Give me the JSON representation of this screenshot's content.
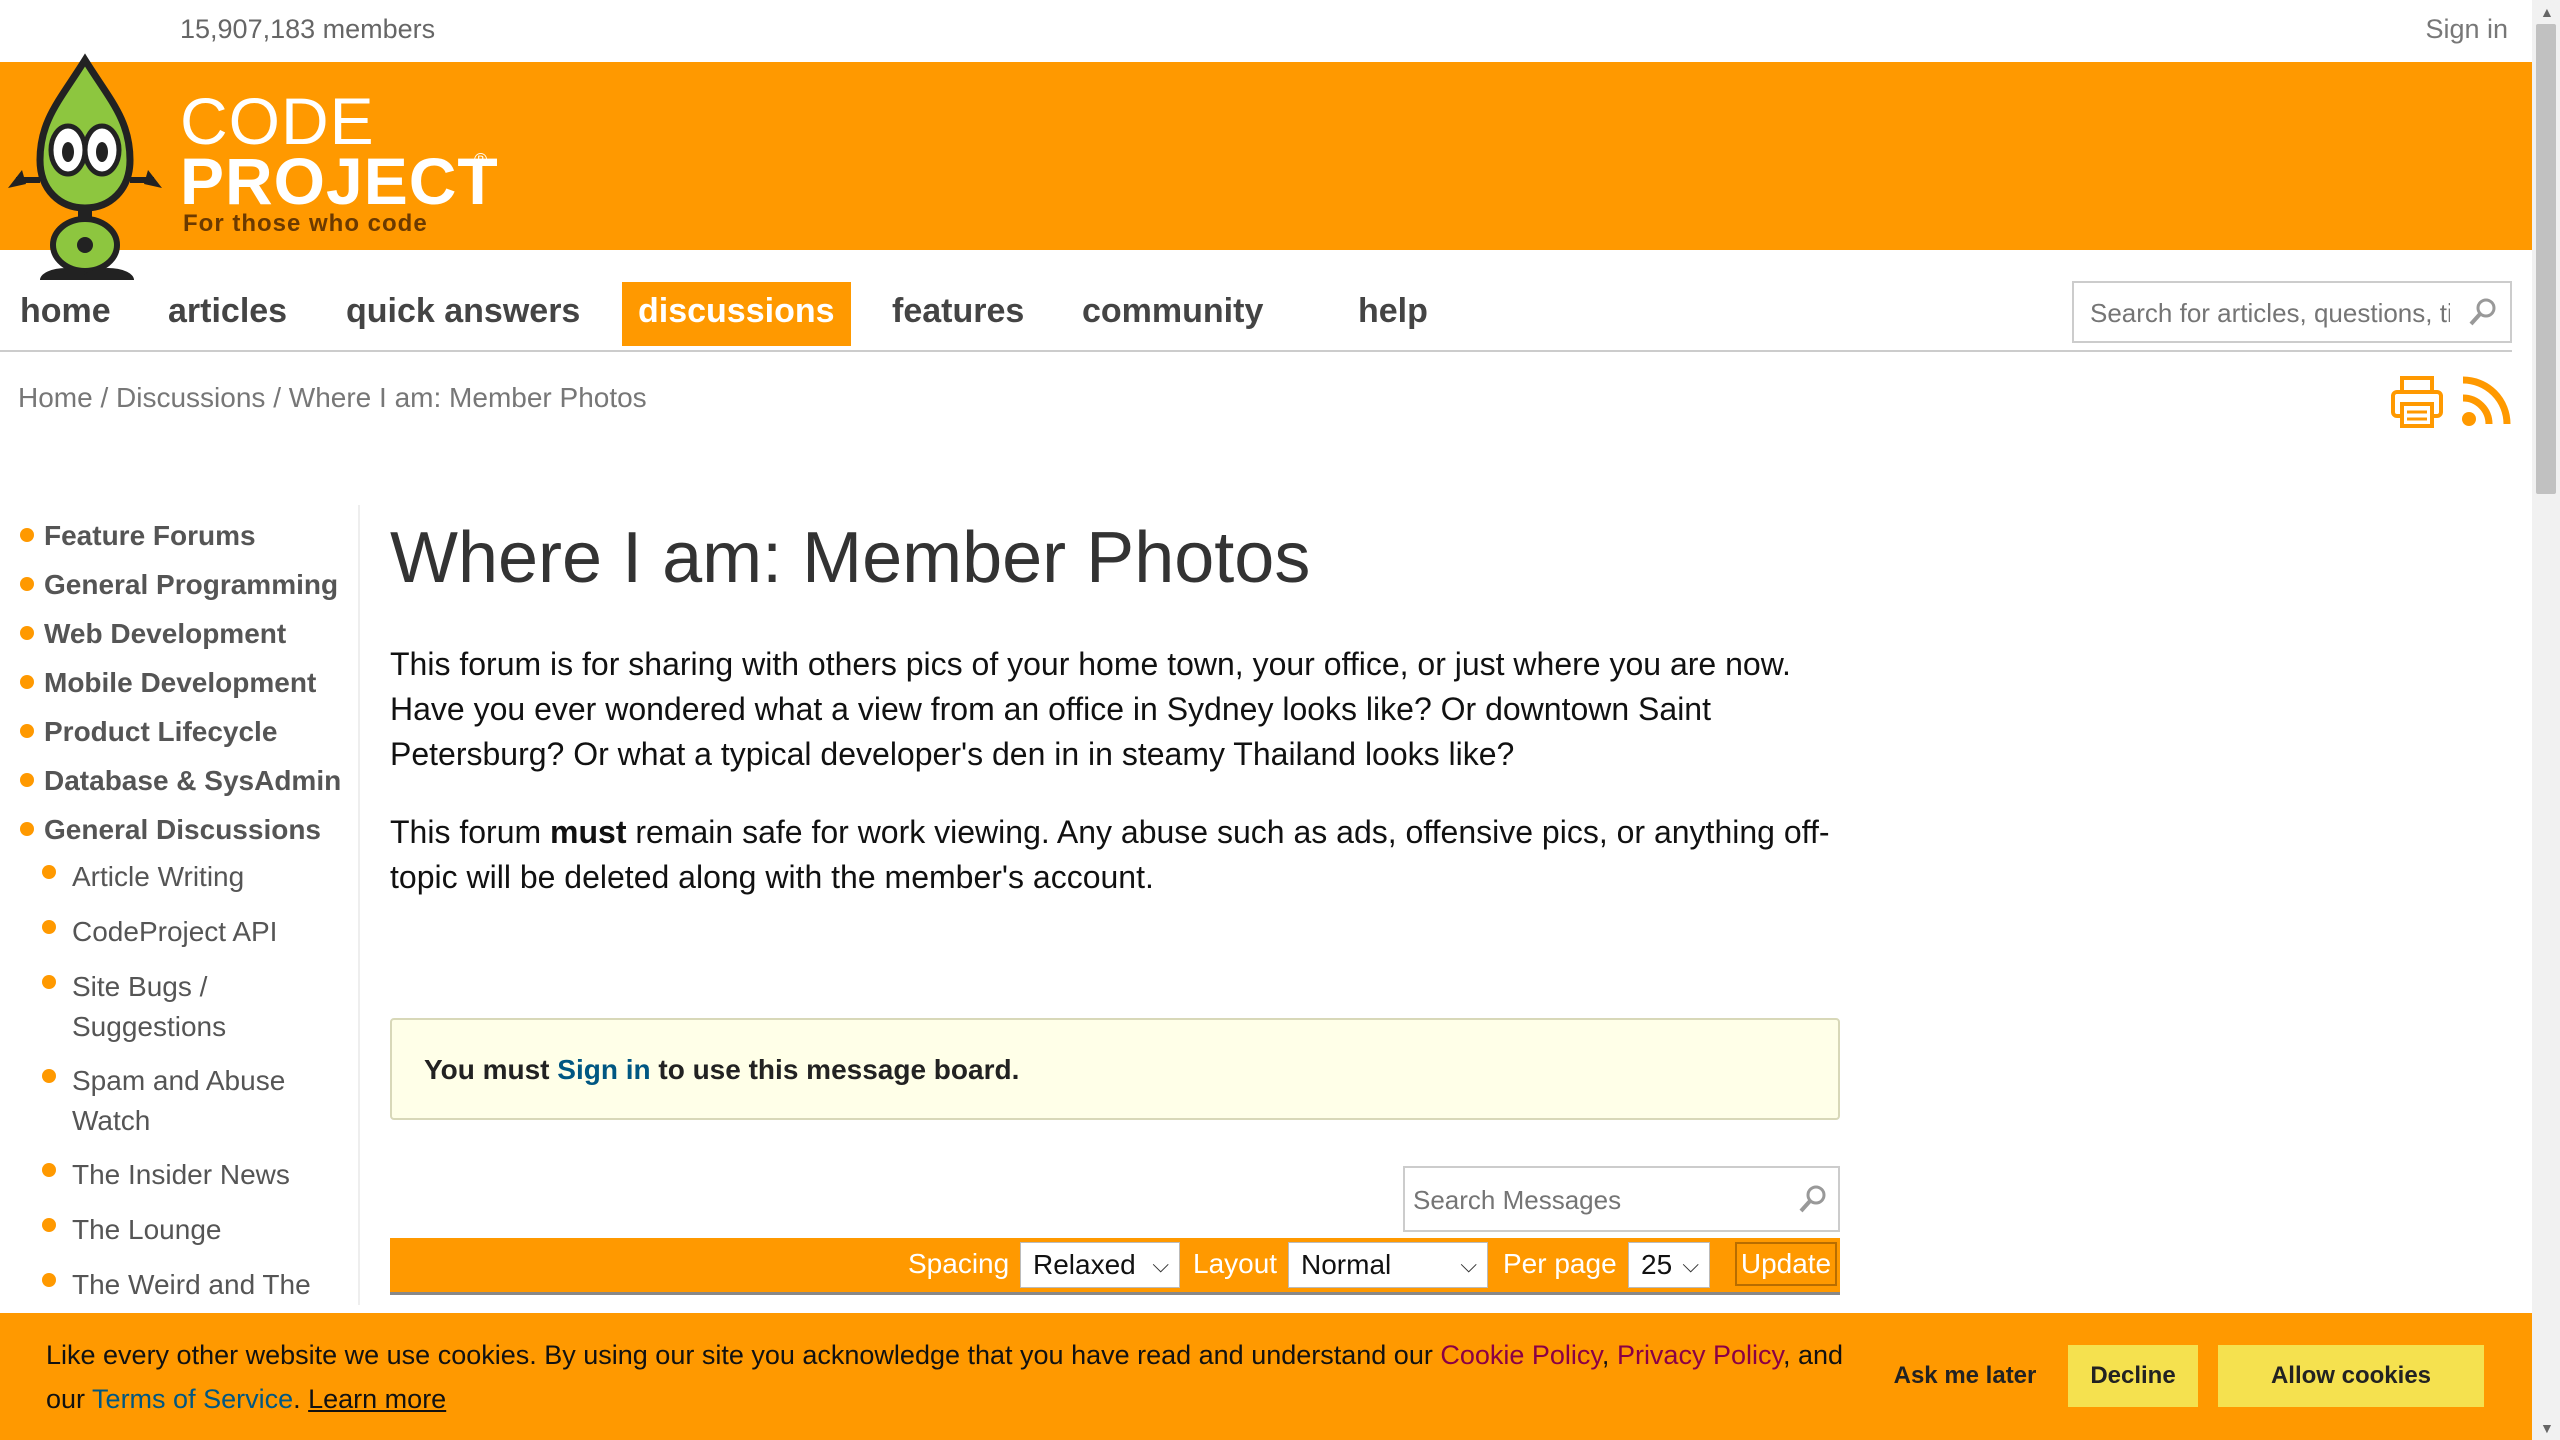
{
  "topbar": {
    "members": "15,907,183 members",
    "signin": "Sign in"
  },
  "logo": {
    "code": "CODE",
    "project": "PROJECT",
    "reg": "®",
    "tagline": "For those who code"
  },
  "nav": {
    "items": [
      {
        "label": "home"
      },
      {
        "label": "articles"
      },
      {
        "label": "quick answers"
      },
      {
        "label": "discussions"
      },
      {
        "label": "features"
      },
      {
        "label": "community"
      },
      {
        "label": "help"
      }
    ],
    "active": "discussions",
    "search_placeholder": "Search for articles, questions, tips"
  },
  "breadcrumb": {
    "home": "Home",
    "discussions": "Discussions",
    "current": "Where I am: Member Photos",
    "sep": " / "
  },
  "sidebar": {
    "main_items": [
      "Feature Forums",
      "General Programming",
      "Web Development",
      "Mobile Development",
      "Product Lifecycle",
      "Database & SysAdmin",
      "General Discussions"
    ],
    "sub_items": [
      "Article Writing",
      "CodeProject API",
      "Site Bugs / Suggestions",
      "Spam and Abuse Watch",
      "The Insider News",
      "The Lounge",
      "The Weird and The"
    ]
  },
  "main": {
    "title": "Where I am: Member Photos",
    "para1": "This forum is for sharing with others pics of your home town, your office, or just where you are now. Have you ever wondered what a view from an office in Sydney looks like? Or downtown Saint Petersburg? Or what a typical developer's den in in steamy Thailand looks like?",
    "para2_a": "This forum ",
    "para2_b": "must",
    "para2_c": " remain safe for work viewing. Any abuse such as ads, offensive pics, or anything off-topic will be deleted along with the member's account.",
    "notice_a": "You must ",
    "notice_link": "Sign in",
    "notice_b": " to use this message board.",
    "msg_search_placeholder": "Search Messages"
  },
  "toolbar": {
    "spacing_label": "Spacing",
    "spacing_value": "Relaxed",
    "layout_label": "Layout",
    "layout_value": "Normal",
    "perpage_label": "Per page",
    "perpage_value": "25",
    "update": "Update"
  },
  "cookie": {
    "text_a": "Like every other website we use cookies. By using our site you acknowledge that you have read and understand our ",
    "cookie_policy": "Cookie Policy",
    "comma": ", ",
    "privacy_policy": "Privacy Policy",
    "and_our": ", and our ",
    "terms": "Terms of Service",
    "period": ". ",
    "learn_more": "Learn more",
    "ask_later": "Ask me later",
    "decline": "Decline",
    "allow": "Allow cookies"
  },
  "colors": {
    "brand": "#ff9900",
    "link": "#005782",
    "policy_link": "#8b0044",
    "button_yellow": "#f5e14f"
  }
}
